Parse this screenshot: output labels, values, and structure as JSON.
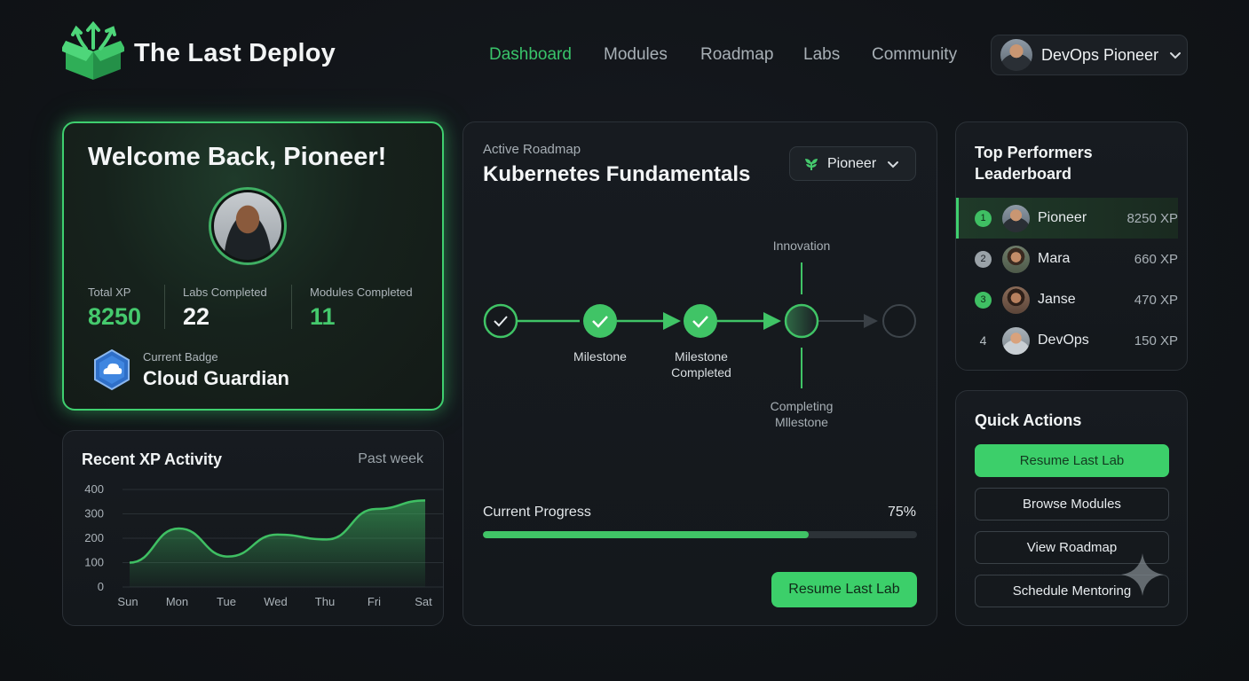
{
  "app": {
    "brand": "The Last Deploy"
  },
  "nav": [
    {
      "label": "Dashboard",
      "active": true
    },
    {
      "label": "Modules",
      "active": false
    },
    {
      "label": "Roadmap",
      "active": false
    },
    {
      "label": "Labs",
      "active": false
    },
    {
      "label": "Community",
      "active": false
    }
  ],
  "user": {
    "name": "DevOps Pioneer",
    "icon": "chevron-down-icon"
  },
  "welcome": {
    "title": "Welcome Back, Pioneer!",
    "stats": [
      {
        "label": "Total XP",
        "value": "8250"
      },
      {
        "label": "Labs Completed",
        "value": "22"
      },
      {
        "label": "Modules Completed",
        "value": "11"
      }
    ],
    "badge_label": "Current Badge",
    "badge_name": "Cloud Guardian"
  },
  "xp_activity": {
    "title": "Recent XP Activity",
    "period": "Past week"
  },
  "chart_data": {
    "type": "area",
    "title": "Recent XP Activity",
    "categories": [
      "Sun",
      "Mon",
      "Tue",
      "Wed",
      "Thu",
      "Fri",
      "Sat"
    ],
    "values": [
      100,
      240,
      125,
      215,
      195,
      320,
      355
    ],
    "yticks": [
      0,
      100,
      200,
      300,
      400
    ],
    "ylim": [
      0,
      400
    ],
    "grid": true,
    "color": "#3fbf63"
  },
  "roadmap": {
    "subtitle": "Active Roadmap",
    "title": "Kubernetes Fundamentals",
    "level": "Pioneer",
    "milestones": {
      "m2": "Milestone",
      "m3": "Milestone Completed",
      "top": "Innovation",
      "bottom": "Completing Mllestone"
    },
    "progress_label": "Current Progress",
    "progress_pct": "75%",
    "progress_value": 0.75,
    "button": "Resume Last Lab"
  },
  "leaderboard": {
    "title": "Top Performers Leaderboard",
    "rows": [
      {
        "rank": "1",
        "name": "Pioneer",
        "xp": "8250 XP"
      },
      {
        "rank": "2",
        "name": "Mara",
        "xp": "660 XP"
      },
      {
        "rank": "3",
        "name": "Janse",
        "xp": "470 XP"
      },
      {
        "rank": "4",
        "name": "DevOps",
        "xp": "150 XP"
      }
    ]
  },
  "quick_actions": {
    "title": "Quick Actions",
    "buttons": [
      "Resume Last Lab",
      "Browse Modules",
      "View Roadmap",
      "Schedule Mentoring"
    ]
  },
  "colors": {
    "accent": "#3ccf6a",
    "background": "#111418",
    "card": "#171b20"
  }
}
